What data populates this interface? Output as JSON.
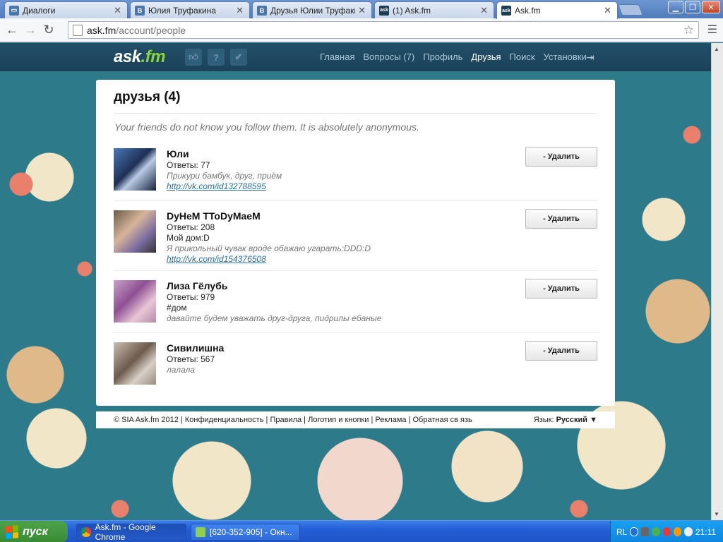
{
  "browser": {
    "tabs": [
      {
        "title": "Диалоги",
        "favicon": "vk-dialog-icon",
        "active": false
      },
      {
        "title": "Юлия Труфакина",
        "favicon": "vk-icon",
        "active": false
      },
      {
        "title": "Друзья Юлии Труфакин",
        "favicon": "vk-icon",
        "active": false
      },
      {
        "title": "(1) Ask.fm",
        "favicon": "askfm-icon",
        "active": false
      },
      {
        "title": "Ask.fm",
        "favicon": "askfm-icon",
        "active": true
      }
    ],
    "address": {
      "host": "ask.fm",
      "path": "/account/people"
    }
  },
  "site": {
    "logo_main": "ask",
    "logo_suffix": ".fm",
    "header_icons": [
      "like-icon",
      "question-icon",
      "answer-icon"
    ],
    "nav": [
      {
        "label": "Главная",
        "active": false
      },
      {
        "label": "Вопросы (7)",
        "active": false
      },
      {
        "label": "Профиль",
        "active": false
      },
      {
        "label": "Друзья",
        "active": true
      },
      {
        "label": "Поиск",
        "active": false
      },
      {
        "label": "Установки",
        "active": false
      }
    ]
  },
  "main": {
    "title": "друзья (4)",
    "note": "Your friends do not know you follow them. It is absolutely anonymous.",
    "remove_label": "- Удалить",
    "friends": [
      {
        "name": "Юли",
        "answers": "Ответы: 77",
        "extra": "",
        "status": "Прикури бамбук, друг, приём",
        "link": "http://vk.com/id132788595"
      },
      {
        "name": "DyHeM TToDyMaeM",
        "answers": "Ответы: 208",
        "extra": "Мой дом:D",
        "status": "Я прикольный чувак вроде обажаю угарать:DDD:D",
        "link": "http://vk.com/id154376508"
      },
      {
        "name": "Лиза Гёлубь",
        "answers": "Ответы: 979",
        "extra": "#дом",
        "status": "давайте будем уважать друг-друга, пидрилы ебаные",
        "link": ""
      },
      {
        "name": "Сивилишна",
        "answers": "Ответы: 567",
        "extra": "",
        "status": "лалала",
        "link": ""
      }
    ]
  },
  "footer": {
    "copyright": "© SIA Ask.fm 2012",
    "links": [
      "Конфиденциальность",
      "Правила",
      "Логотип и кнопки",
      "Реклама",
      "Обратная св язь"
    ],
    "lang_label": "Язык:",
    "lang_value": "Русский"
  },
  "taskbar": {
    "start": "пуск",
    "tasks": [
      {
        "label": "Ask.fm - Google Chrome",
        "active": true
      },
      {
        "label": "[620-352-905] - Окн...",
        "active": false
      }
    ],
    "tray_lang": "RL",
    "clock": "21:11"
  },
  "colors": {
    "header_bg": "#1f4a63",
    "link": "#2a6f9b",
    "logo_accent": "#8ad43a",
    "page_bg": "#2d7a8b"
  }
}
